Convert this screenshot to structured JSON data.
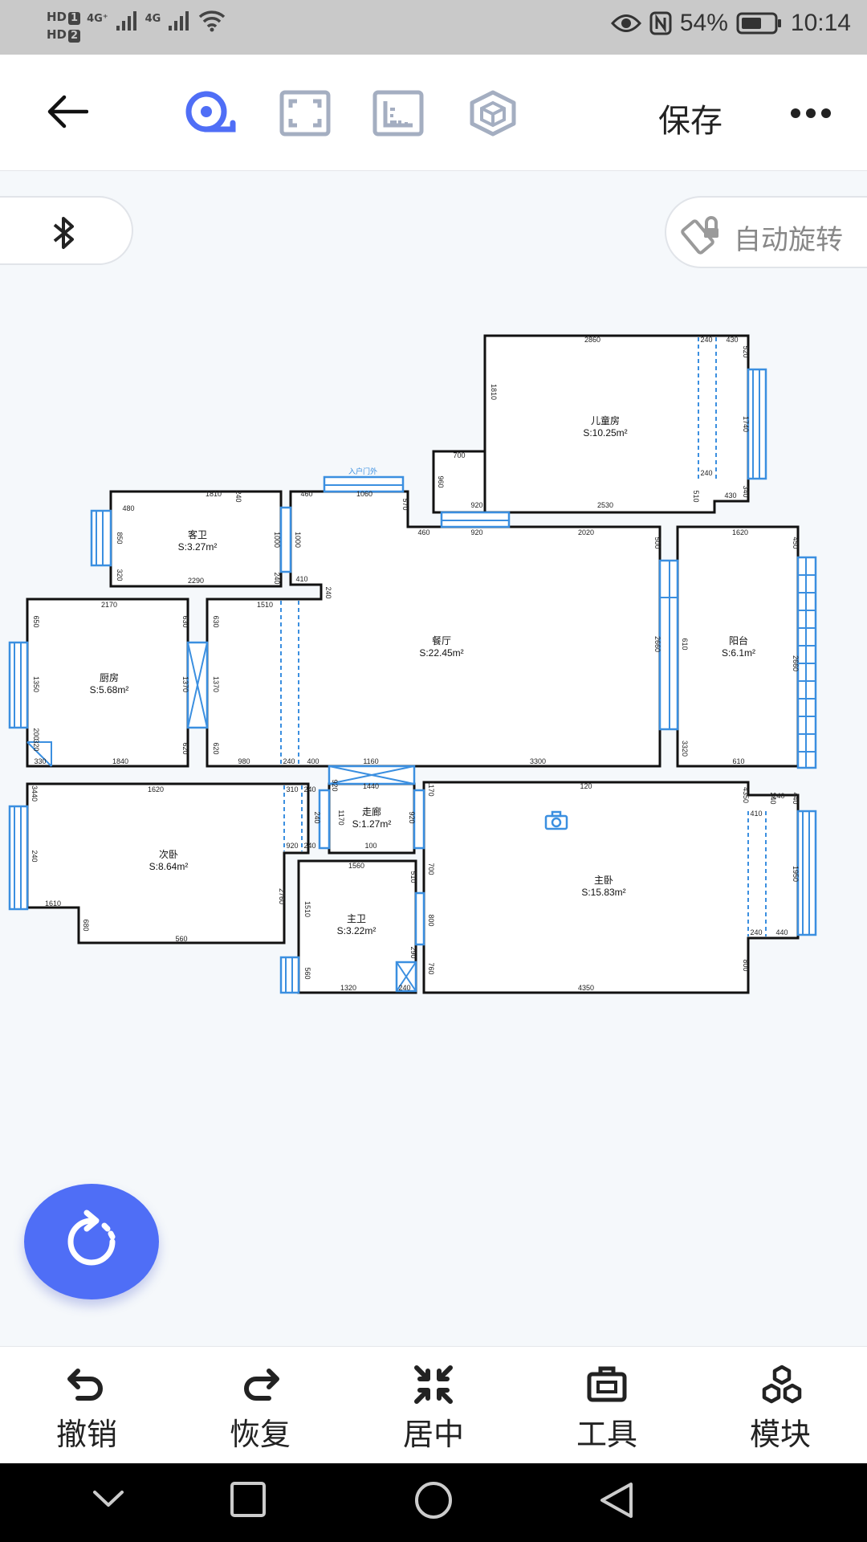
{
  "status": {
    "hd1": "HD",
    "hd1_num": "1",
    "hd2": "HD",
    "hd2_num": "2",
    "net1": "4G⁺",
    "net2": "4G",
    "battery": "54%",
    "time": "10:14"
  },
  "toolbar": {
    "tools": [
      {
        "name": "tape-measure-icon",
        "active": true
      },
      {
        "name": "frame-icon",
        "active": false
      },
      {
        "name": "wall-icon",
        "active": false
      },
      {
        "name": "cube-icon",
        "active": false
      }
    ],
    "save_label": "保存"
  },
  "auto_rotate_label": "自动旋转",
  "floorplan": {
    "entrance_label": "入户门外",
    "rooms": [
      {
        "key": "kids",
        "name": "儿童房",
        "area": "S:10.25m²"
      },
      {
        "key": "guest_bath",
        "name": "客卫",
        "area": "S:3.27m²"
      },
      {
        "key": "dining",
        "name": "餐厅",
        "area": "S:22.45m²"
      },
      {
        "key": "balcony",
        "name": "阳台",
        "area": "S:6.1m²"
      },
      {
        "key": "kitchen",
        "name": "厨房",
        "area": "S:5.68m²"
      },
      {
        "key": "corridor",
        "name": "走廊",
        "area": "S:1.27m²"
      },
      {
        "key": "second_bed",
        "name": "次卧",
        "area": "S:8.64m²"
      },
      {
        "key": "master_bath",
        "name": "主卫",
        "area": "S:3.22m²"
      },
      {
        "key": "master_bed",
        "name": "主卧",
        "area": "S:15.83m²"
      }
    ],
    "dimensions": [
      "2860",
      "240",
      "430",
      "520",
      "1740",
      "1810",
      "700",
      "960",
      "240",
      "510",
      "430",
      "340",
      "920",
      "2530",
      "1810",
      "240",
      "480",
      "850",
      "320",
      "2290",
      "1000",
      "1000",
      "240",
      "460",
      "1060",
      "570",
      "410",
      "240",
      "460",
      "920",
      "2020",
      "500",
      "1620",
      "450",
      "2170",
      "630",
      "650",
      "1350",
      "200",
      "320",
      "330",
      "1840",
      "620",
      "1370",
      "1510",
      "630",
      "1370",
      "620",
      "980",
      "240",
      "400",
      "1160",
      "3300",
      "2660",
      "610",
      "2660",
      "3320",
      "610",
      "1620",
      "3440",
      "310",
      "240",
      "240",
      "920",
      "240",
      "240",
      "1610",
      "680",
      "560",
      "2760",
      "1440",
      "1170",
      "920",
      "920",
      "100",
      "1170",
      "120",
      "4350",
      "410",
      "240",
      "240",
      "440",
      "1950",
      "240",
      "440",
      "1560",
      "1510",
      "700",
      "510",
      "800",
      "290",
      "560",
      "1320",
      "240",
      "760",
      "4350",
      "800"
    ]
  },
  "bottom_bar": [
    {
      "name": "undo",
      "label": "撤销"
    },
    {
      "name": "redo",
      "label": "恢复"
    },
    {
      "name": "center",
      "label": "居中"
    },
    {
      "name": "tools",
      "label": "工具"
    },
    {
      "name": "modules",
      "label": "模块"
    }
  ]
}
